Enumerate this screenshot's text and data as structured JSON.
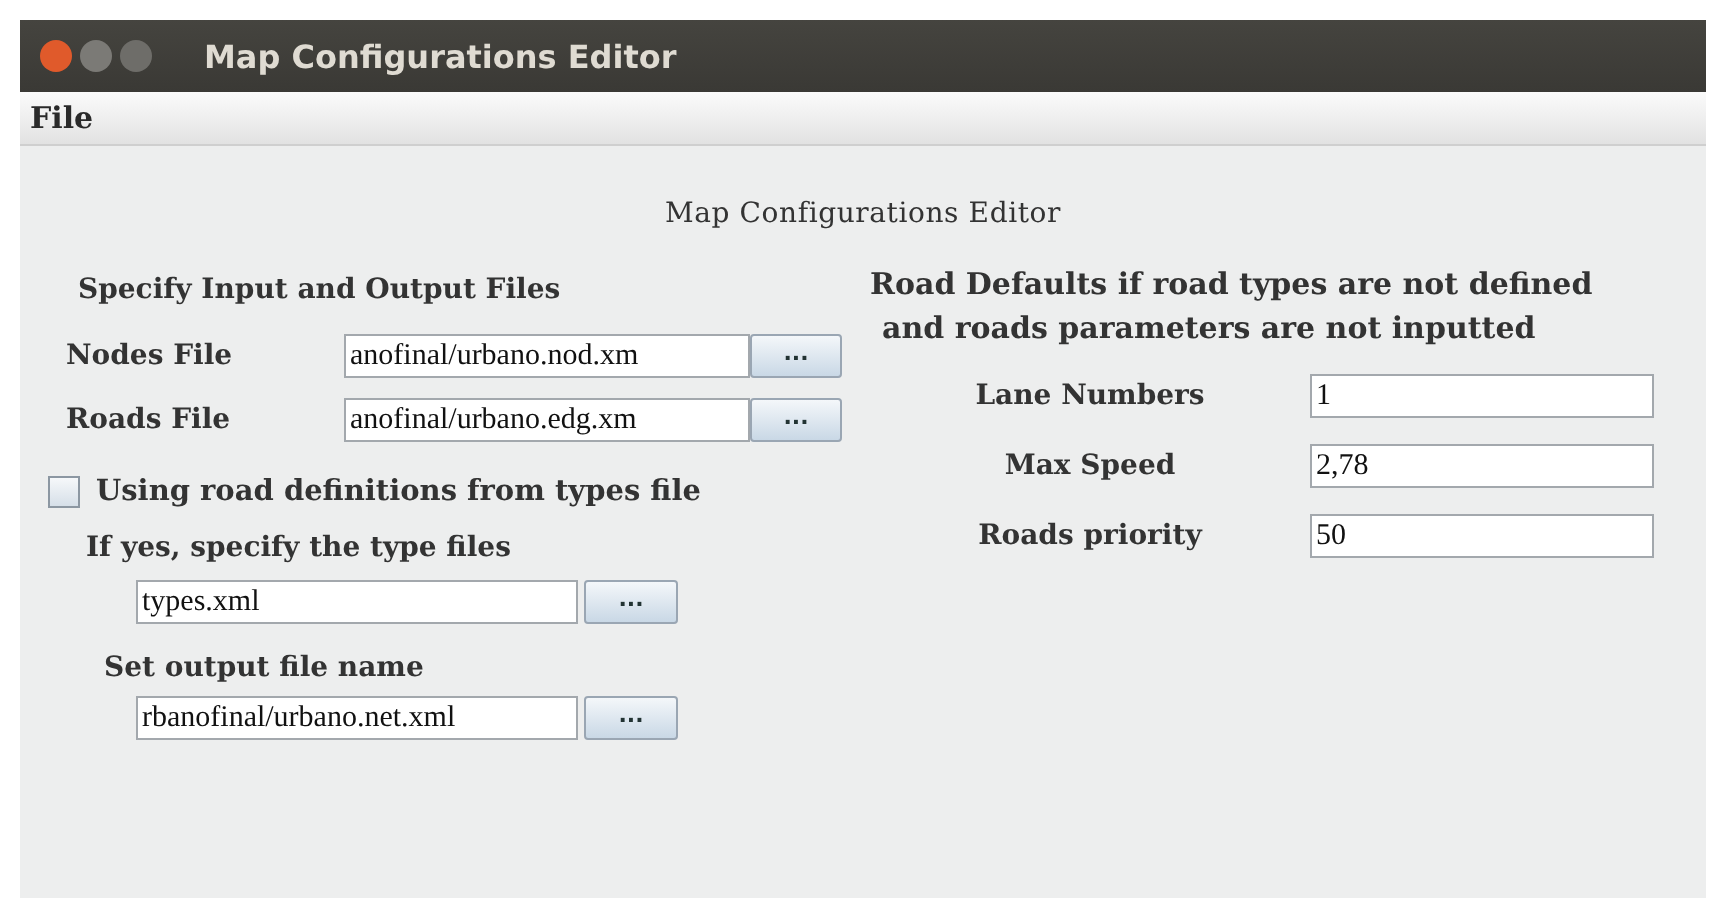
{
  "window": {
    "title": "Map Configurations Editor"
  },
  "menu": [
    "File"
  ],
  "heading": "Map Configurations Editor",
  "files": {
    "title": "Specify Input and Output Files",
    "rows": [
      {
        "label": "Nodes File",
        "value": "anofinal/urbano.nod.xm",
        "button": "..."
      },
      {
        "label": "Roads File",
        "value": "anofinal/urbano.edg.xm",
        "button": "..."
      }
    ],
    "types_checkbox": {
      "label": "Using road definitions from types file",
      "checked": false
    },
    "types": {
      "label": "If yes, specify the type files",
      "value": "types.xml",
      "button": "..."
    },
    "output": {
      "label": "Set output file name",
      "value": "rbanofinal/urbano.net.xml",
      "button": "..."
    }
  },
  "defaults": {
    "title": [
      "Road Defaults if road types are not defined",
      "and roads parameters are not inputted"
    ],
    "rows": [
      {
        "label": "Lane Numbers",
        "value": "1"
      },
      {
        "label": "Max Speed",
        "value": "2,78"
      },
      {
        "label": "Roads priority",
        "value": "50"
      }
    ]
  }
}
